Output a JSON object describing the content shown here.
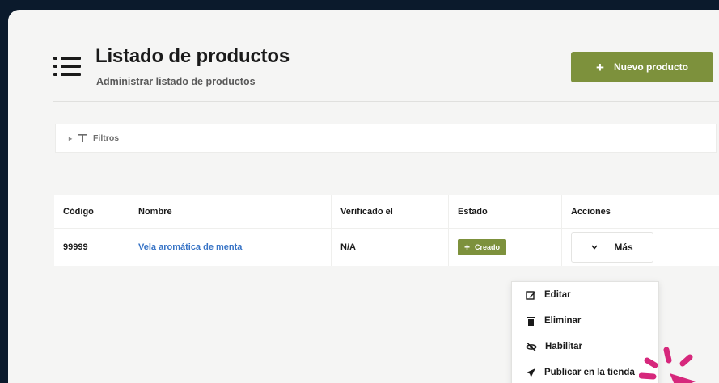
{
  "header": {
    "title": "Listado de productos",
    "subtitle": "Administrar listado de productos",
    "new_button": "Nuevo producto"
  },
  "filters": {
    "label": "Filtros"
  },
  "table": {
    "columns": [
      "Código",
      "Nombre",
      "Verificado el",
      "Estado",
      "Acciones"
    ],
    "rows": [
      {
        "codigo": "99999",
        "nombre": "Vela aromática de menta",
        "verificado": "N/A",
        "estado": "Creado",
        "accion": "Más"
      }
    ]
  },
  "dropdown": {
    "items": [
      {
        "label": "Editar",
        "icon": "edit-icon"
      },
      {
        "label": "Eliminar",
        "icon": "trash-icon"
      },
      {
        "label": "Habilitar",
        "icon": "eye-slash-icon"
      },
      {
        "label": "Publicar en la tienda",
        "icon": "paper-plane-icon"
      }
    ]
  },
  "colors": {
    "primary": "#7d913c",
    "link": "#3874c6",
    "highlight": "#d6287c",
    "frame_bg": "#0b1a2c"
  }
}
